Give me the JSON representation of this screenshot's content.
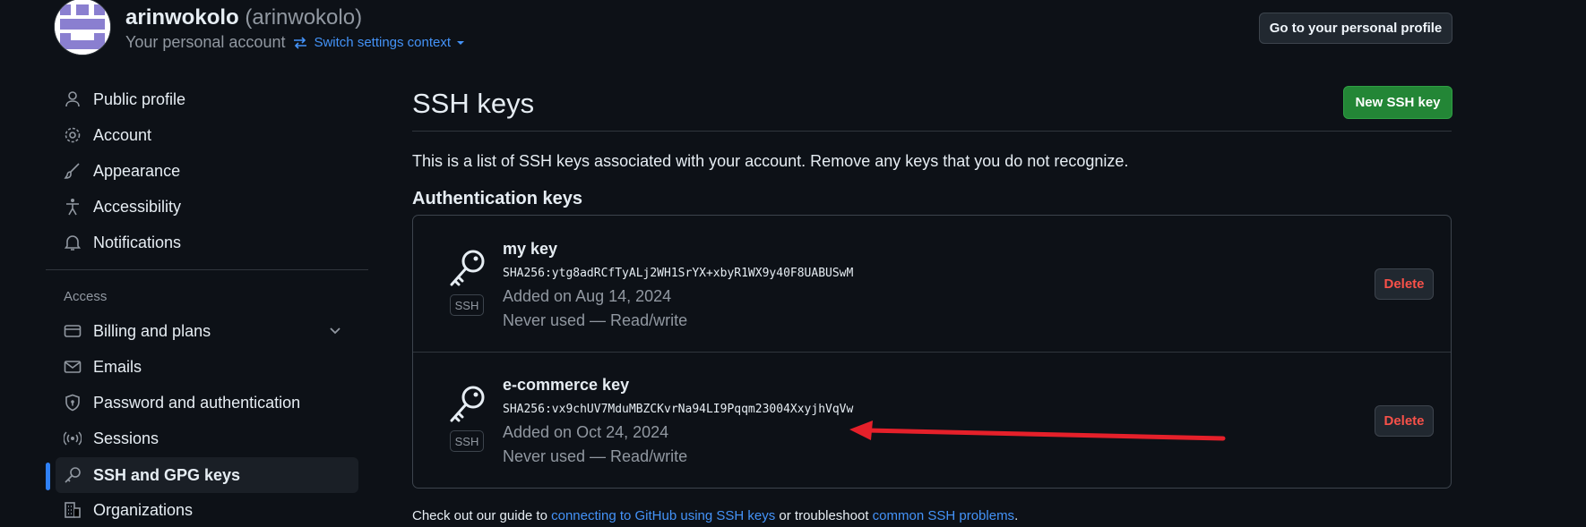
{
  "header": {
    "display_name": "arinwokolo",
    "handle": "(arinwokolo)",
    "subtitle": "Your personal account",
    "switch_label": "Switch settings context",
    "profile_button": "Go to your personal profile"
  },
  "sidebar": {
    "items": [
      {
        "label": "Public profile",
        "icon": "person-icon"
      },
      {
        "label": "Account",
        "icon": "gear-icon"
      },
      {
        "label": "Appearance",
        "icon": "paintbrush-icon"
      },
      {
        "label": "Accessibility",
        "icon": "accessibility-icon"
      },
      {
        "label": "Notifications",
        "icon": "bell-icon"
      }
    ],
    "access_heading": "Access",
    "access_items": [
      {
        "label": "Billing and plans",
        "icon": "credit-card-icon"
      },
      {
        "label": "Emails",
        "icon": "mail-icon"
      },
      {
        "label": "Password and authentication",
        "icon": "shield-lock-icon"
      },
      {
        "label": "Sessions",
        "icon": "broadcast-icon"
      },
      {
        "label": "SSH and GPG keys",
        "icon": "key-icon",
        "active": true
      },
      {
        "label": "Organizations",
        "icon": "organization-icon"
      }
    ]
  },
  "main": {
    "title": "SSH keys",
    "new_button": "New SSH key",
    "intro": "This is a list of SSH keys associated with your account. Remove any keys that you do not recognize.",
    "section_title": "Authentication keys",
    "keys": [
      {
        "name": "my key",
        "fingerprint": "SHA256:ytg8adRCfTyALj2WH1SrYX+xbyR1WX9y40F8UABUSwM",
        "added": "Added on Aug 14, 2024",
        "usage": "Never used — Read/write",
        "badge": "SSH",
        "delete_label": "Delete"
      },
      {
        "name": "e-commerce key",
        "fingerprint": "SHA256:vx9chUV7MduMBZCKvrNa94LI9Pqqm23004XxyjhVqVw",
        "added": "Added on Oct 24, 2024",
        "usage": "Never used — Read/write",
        "badge": "SSH",
        "delete_label": "Delete"
      }
    ],
    "footer": {
      "prefix": "Check out our guide to",
      "link1": "connecting to GitHub using SSH keys",
      "middle": "or troubleshoot",
      "link2": "common SSH problems",
      "suffix": "."
    }
  },
  "colors": {
    "background": "#0d1117",
    "accent_link": "#4493f8",
    "primary_button": "#238636",
    "danger": "#f85149",
    "annotation_arrow": "#e5202a"
  }
}
